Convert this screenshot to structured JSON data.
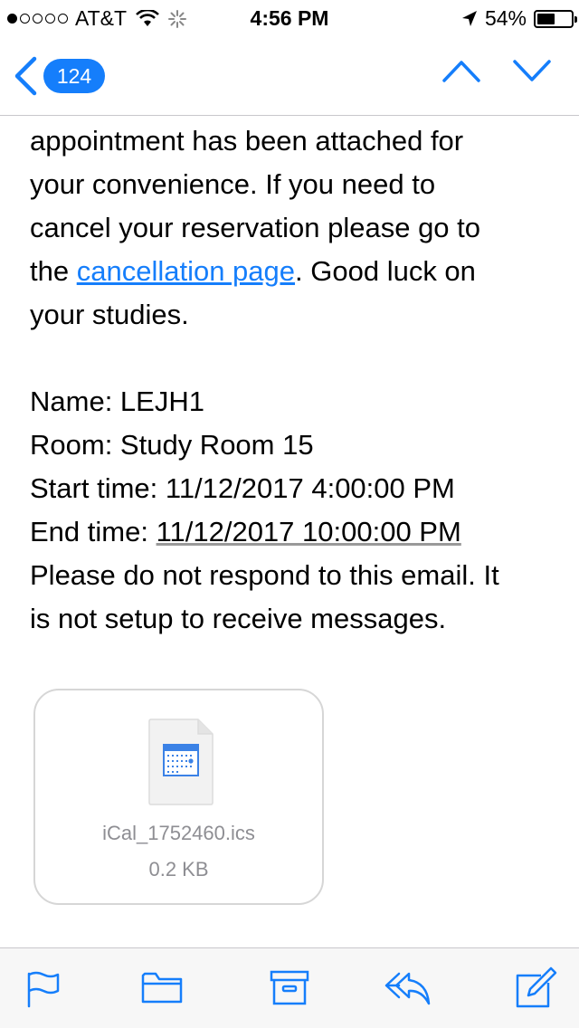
{
  "status_bar": {
    "carrier": "AT&T",
    "time": "4:56 PM",
    "battery": "54%",
    "battery_level": 0.54
  },
  "nav": {
    "unread_count": "124"
  },
  "email": {
    "line1": "appointment has been attached for",
    "line2": "your convenience. If you need to",
    "line3": "cancel your reservation please go to",
    "line4_pre": "the ",
    "link_text": "cancellation page",
    "line4_post": ". Good luck on",
    "line5": "your studies.",
    "name_label": "Name: LEJH1",
    "room_label": "Room: Study Room 15",
    "start_label": "Start time: ",
    "start_value": "11/12/2017 4:00:00 PM",
    "end_label": "End time: ",
    "end_value": "11/12/2017 10:00:00 PM",
    "footer_line1": "Please do not respond to this email. It",
    "footer_line2": "is not setup to receive messages."
  },
  "attachment": {
    "file_name": "iCal_1752460.ics",
    "file_size": "0.2 KB"
  },
  "colors": {
    "accent": "#157efb"
  }
}
